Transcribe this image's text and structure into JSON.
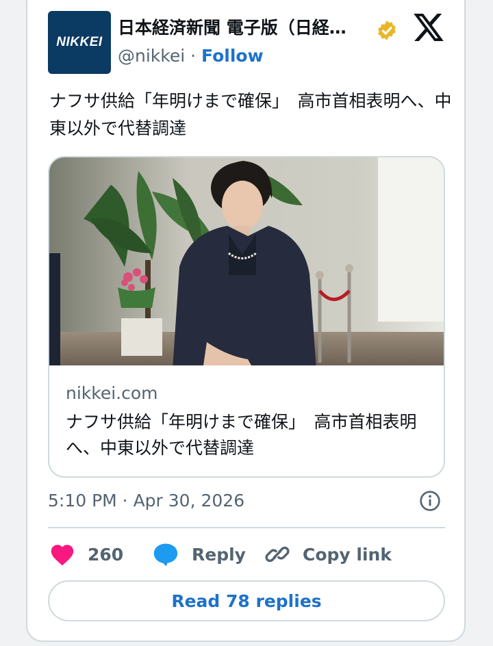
{
  "tweet": {
    "author": {
      "avatar_text": "NIKKEI",
      "name": "日本経済新聞 電子版（日経…",
      "handle": "@nikkei",
      "separator": "·",
      "follow_label": "Follow"
    },
    "text": "ナフサ供給「年明けまで確保」　高市首相表明へ、中東以外で代替調達",
    "link_card": {
      "domain": "nikkei.com",
      "title": "ナフサ供給「年明けまで確保」　高市首相表明へ、中東以外で代替調達"
    },
    "timestamp": "5:10 PM · Apr 30, 2026",
    "actions": {
      "like_count": "260",
      "reply_label": "Reply",
      "copy_link_label": "Copy link"
    },
    "read_replies_label": "Read 78 replies"
  },
  "colors": {
    "accent": "#1d72c9",
    "like": "#f91880",
    "reply_icon": "#1d9bf0",
    "verified": "#e8b829",
    "avatar_bg": "#0b3a62"
  },
  "icons": [
    "verified-badge-icon",
    "x-logo-icon",
    "info-icon",
    "heart-icon",
    "reply-bubble-icon",
    "link-icon"
  ]
}
